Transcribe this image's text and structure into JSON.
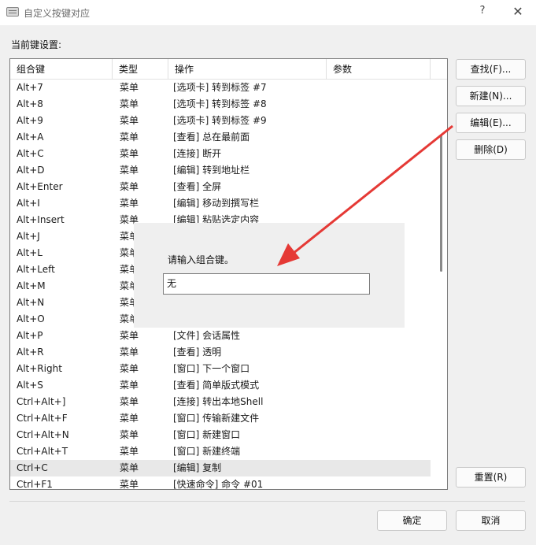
{
  "window": {
    "title": "自定义按键对应",
    "help_glyph": "?",
    "close_glyph": "✕",
    "app_icon": "keyboard-icon"
  },
  "section_label": "当前键设置:",
  "table": {
    "columns": [
      "组合键",
      "类型",
      "操作",
      "参数"
    ],
    "rows": [
      [
        "Alt+7",
        "菜单",
        "[选项卡] 转到标签 #7"
      ],
      [
        "Alt+8",
        "菜单",
        "[选项卡] 转到标签 #8"
      ],
      [
        "Alt+9",
        "菜单",
        "[选项卡] 转到标签 #9"
      ],
      [
        "Alt+A",
        "菜单",
        "[查看] 总在最前面"
      ],
      [
        "Alt+C",
        "菜单",
        "[连接] 断开"
      ],
      [
        "Alt+D",
        "菜单",
        "[编辑] 转到地址栏"
      ],
      [
        "Alt+Enter",
        "菜单",
        "[查看] 全屏"
      ],
      [
        "Alt+I",
        "菜单",
        "[编辑] 移动到撰写栏"
      ],
      [
        "Alt+Insert",
        "菜单",
        "[编辑] 粘贴选定内容"
      ],
      [
        "Alt+J",
        "菜单",
        ""
      ],
      [
        "Alt+L",
        "菜单",
        ""
      ],
      [
        "Alt+Left",
        "菜单",
        ""
      ],
      [
        "Alt+M",
        "菜单",
        ""
      ],
      [
        "Alt+N",
        "菜单",
        ""
      ],
      [
        "Alt+O",
        "菜单",
        ""
      ],
      [
        "Alt+P",
        "菜单",
        "[文件] 会话属性"
      ],
      [
        "Alt+R",
        "菜单",
        "[查看] 透明"
      ],
      [
        "Alt+Right",
        "菜单",
        "[窗口] 下一个窗口"
      ],
      [
        "Alt+S",
        "菜单",
        "[查看] 简单版式模式"
      ],
      [
        "Ctrl+Alt+]",
        "菜单",
        "[连接] 转出本地Shell"
      ],
      [
        "Ctrl+Alt+F",
        "菜单",
        "[窗口] 传输新建文件"
      ],
      [
        "Ctrl+Alt+N",
        "菜单",
        "[窗口] 新建窗口"
      ],
      [
        "Ctrl+Alt+T",
        "菜单",
        "[窗口] 新建终端"
      ],
      [
        "Ctrl+C",
        "菜单",
        "[编辑] 复制"
      ],
      [
        "Ctrl+F1",
        "菜单",
        "[快速命令] 命令 #01"
      ]
    ],
    "selected_row": "Ctrl+C"
  },
  "buttons": {
    "find": "查找(F)...",
    "new": "新建(N)...",
    "edit": "编辑(E)...",
    "delete": "删除(D)",
    "reset": "重置(R)",
    "ok": "确定",
    "cancel": "取消"
  },
  "key_prompt": {
    "label": "请输入组合键。",
    "value": "无"
  },
  "annotation": {
    "arrow_color": "#e53935"
  }
}
